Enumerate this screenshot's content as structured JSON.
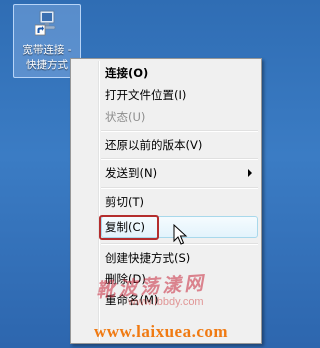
{
  "desktop_icon": {
    "label": "宽带连接 -\n快捷方式",
    "icon": "broadband-connection-shortcut-icon"
  },
  "context_menu": {
    "items": [
      {
        "label": "连接(O)",
        "style": "bold"
      },
      {
        "label": "打开文件位置(I)"
      },
      {
        "label": "状态(U)",
        "style": "disabled"
      },
      {
        "label": "还原以前的版本(V)"
      },
      {
        "label": "发送到(N)",
        "submenu": true
      },
      {
        "label": "剪切(T)"
      },
      {
        "label": "复制(C)",
        "highlighted": true
      },
      {
        "label": "创建快捷方式(S)"
      },
      {
        "label": "删除(D)"
      },
      {
        "label": "重命名(M)"
      }
    ]
  },
  "watermarks": {
    "logo_text": "靴波荡漾网",
    "sub_url": "www.lbbdy.com",
    "site_url": "www.laixuea.com"
  },
  "colors": {
    "desktop": "#2f6db4",
    "menu_bg": "#f0f0f0",
    "highlight_border": "#a8d8eb",
    "annotation_red": "#b42d2d",
    "watermark_orange": "#f07a12"
  }
}
